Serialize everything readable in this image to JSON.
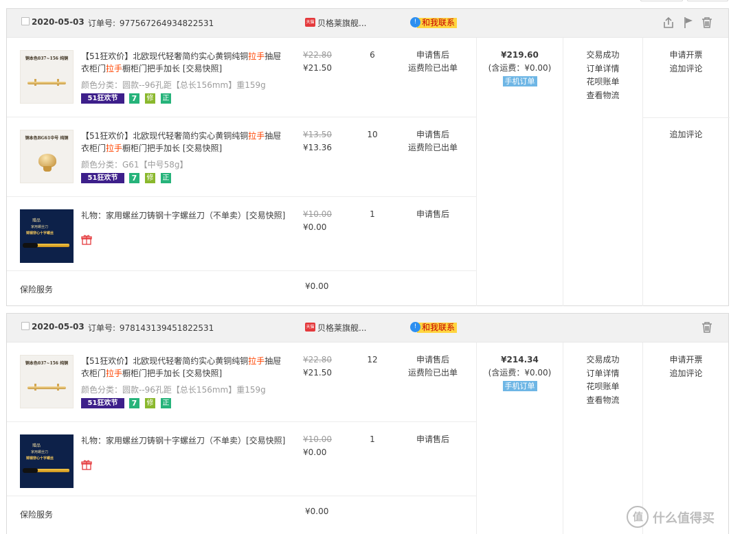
{
  "orders": [
    {
      "date": "2020-05-03",
      "order_no_label": "订单号:",
      "order_no": "977567264934822531",
      "store_badge": "天猫",
      "store": "贝格莱旗舰...",
      "contact": "和我联系",
      "icons": [
        "share-icon",
        "flag-icon",
        "trash-icon"
      ],
      "items": [
        {
          "thumb_caption": "铜本色037~156 纯铜",
          "title_pre": "【51狂欢价】北欧现代轻奢简约实心黄铜纯铜",
          "title_hl1": "拉手",
          "title_mid": "抽屉衣柜门",
          "title_hl2": "拉手",
          "title_post": "橱柜门把手加长 [交易快照]",
          "variant": "颜色分类：圆款--96孔距【总长156mm】重159g",
          "badges": [
            "51狂欢节",
            "7",
            "修",
            "正"
          ],
          "old_price": "¥22.80",
          "price": "¥21.50",
          "qty": "6",
          "actions": [
            "申请售后",
            "运费险已出单"
          ]
        },
        {
          "thumb_caption": "铜本色BG61中号 纯铜",
          "title_pre": "【51狂欢价】北欧现代轻奢简约实心黄铜纯铜",
          "title_hl1": "拉手",
          "title_mid": "抽屉衣柜门",
          "title_hl2": "拉手",
          "title_post": "橱柜门把手加长 [交易快照]",
          "variant": "颜色分类：G61【中号58g】",
          "badges": [
            "51狂欢节",
            "7",
            "修",
            "正"
          ],
          "old_price": "¥13.50",
          "price": "¥13.36",
          "qty": "10",
          "actions": [
            "申请售后",
            "运费险已出单"
          ]
        },
        {
          "gift": true,
          "title": "礼物：家用螺丝刀铸钢十字螺丝刀（不单卖）[交易快照]",
          "old_price": "¥10.00",
          "price": "¥0.00",
          "qty": "1",
          "actions": [
            "申请售后"
          ]
        }
      ],
      "insurance_label": "保险服务",
      "insurance_value": "¥0.00",
      "total": "¥219.60",
      "shipping": "(含运费：¥0.00)",
      "mobile_tag": "手机订单",
      "status_links": [
        "交易成功",
        "订单详情",
        "花呗账单",
        "查看物流"
      ],
      "ops_row1": [
        "申请开票",
        "追加评论"
      ],
      "ops_row2": [
        "追加评论"
      ]
    },
    {
      "date": "2020-05-03",
      "order_no_label": "订单号:",
      "order_no": "978143139451822531",
      "store_badge": "天猫",
      "store": "贝格莱旗舰...",
      "contact": "和我联系",
      "icons": [
        "trash-icon"
      ],
      "items": [
        {
          "thumb_caption": "铜本色037~156 纯铜",
          "title_pre": "【51狂欢价】北欧现代轻奢简约实心黄铜纯铜",
          "title_hl1": "拉手",
          "title_mid": "抽屉衣柜门",
          "title_hl2": "拉手",
          "title_post": "橱柜门把手加长 [交易快照]",
          "variant": "颜色分类：圆款--96孔距【总长156mm】重159g",
          "badges": [
            "51狂欢节",
            "7",
            "修",
            "正"
          ],
          "old_price": "¥22.80",
          "price": "¥21.50",
          "qty": "12",
          "actions": [
            "申请售后",
            "运费险已出单"
          ]
        },
        {
          "gift": true,
          "title": "礼物：家用螺丝刀铸钢十字螺丝刀（不单卖）[交易快照]",
          "old_price": "¥10.00",
          "price": "¥0.00",
          "qty": "1",
          "actions": [
            "申请售后"
          ]
        }
      ],
      "insurance_label": "保险服务",
      "insurance_value": "¥0.00",
      "total": "¥214.34",
      "shipping": "(含运费：¥0.00)",
      "mobile_tag": "手机订单",
      "status_links": [
        "交易成功",
        "订单详情",
        "花呗账单",
        "查看物流"
      ],
      "ops_row1": [
        "申请开票",
        "追加评论"
      ]
    }
  ],
  "gift_thumb": {
    "tag": "赠品",
    "line1": "家用螺丝刀",
    "line2": "铸钢穿心十字螺丝"
  },
  "watermark": {
    "glyph": "值",
    "text": "什么值得买"
  },
  "colors": {
    "highlight": "#ff4400",
    "contact_bg": "#ffd53f",
    "mobile_tag": "#6eb6e5",
    "badge_51": "#3d1f8a"
  }
}
